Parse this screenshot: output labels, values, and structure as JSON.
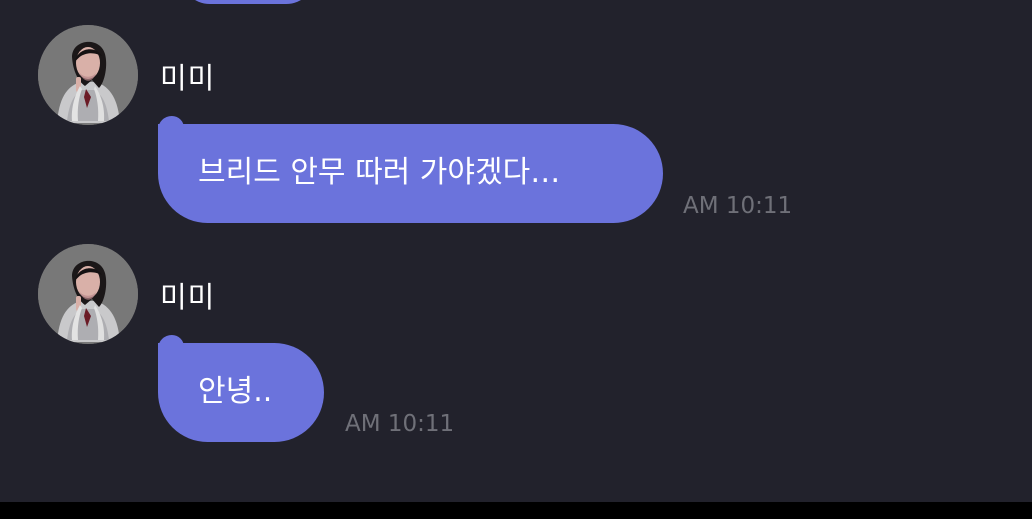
{
  "conversation": {
    "messages": [
      {
        "sender": "미미",
        "text": "브리드 안무 따러 가야겠다…",
        "time": "AM 10:11"
      },
      {
        "sender": "미미",
        "text": "안녕..",
        "time": "AM 10:11"
      }
    ]
  },
  "colors": {
    "background": "#22222c",
    "bubble": "#6b73dc",
    "timestamp": "#6f7078",
    "bottom_bar": "#000000"
  },
  "icons": {
    "avatar": "profile-photo"
  }
}
